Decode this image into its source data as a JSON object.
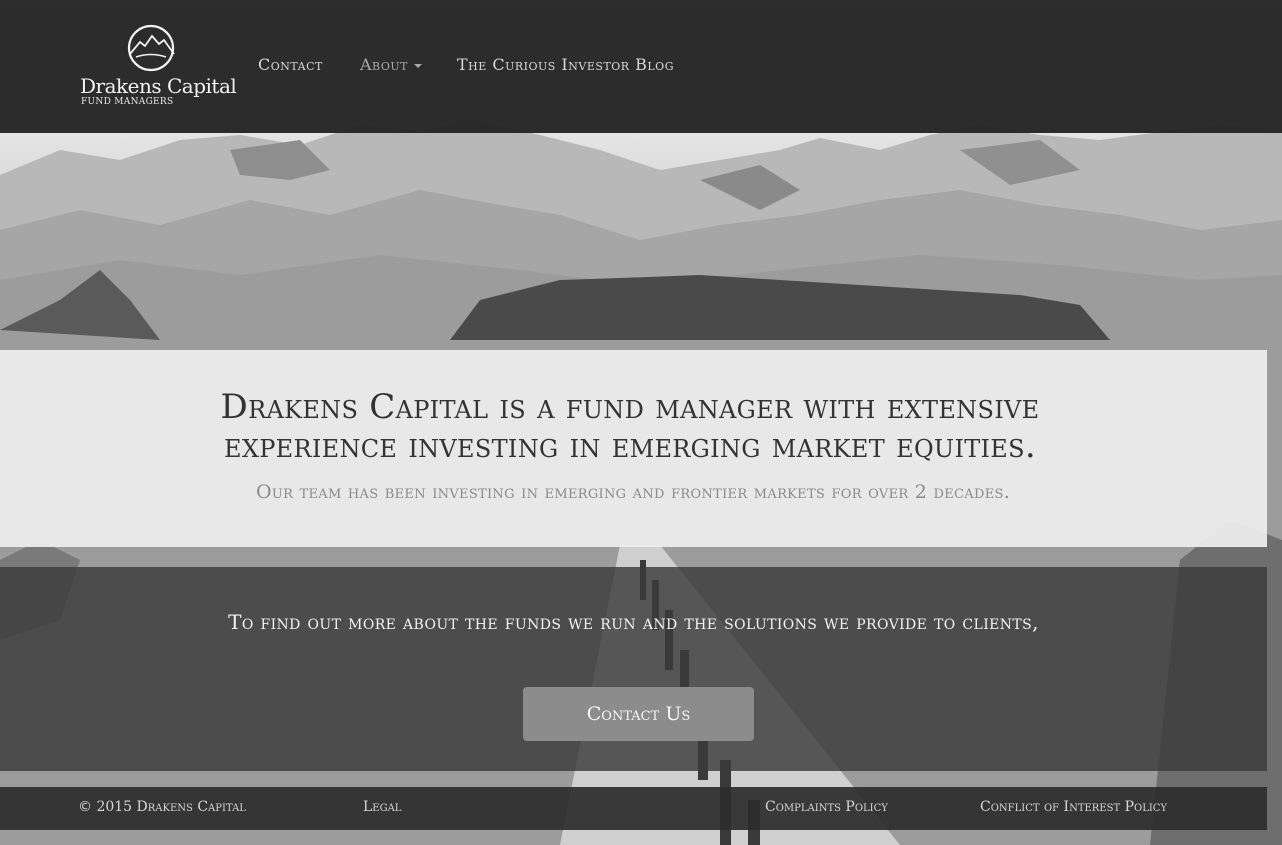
{
  "brand": {
    "name": "Drakens Capital",
    "tagline": "FUND MANAGERS",
    "logo_icon": "mountain-sun-icon"
  },
  "nav": {
    "contact": "Contact",
    "about": "About",
    "blog": "The Curious Investor Blog"
  },
  "hero": {
    "title": "Drakens Capital is a fund manager with extensive experience investing in emerging market equities.",
    "subtitle": "Our team has been investing in emerging and frontier markets for over 2 decades."
  },
  "cta": {
    "text": "To find out more about the funds we run and the solutions we provide to clients,",
    "button": "Contact Us"
  },
  "footer": {
    "copyright_symbol": "©",
    "copyright": "2015 Drakens Capital",
    "legal": "Legal",
    "complaints": "Complaints Policy",
    "conflict": "Conflict of Interest Policy"
  },
  "colors": {
    "navbar": "#222222",
    "panel_light": "#eeeeee",
    "panel_dark": "#3a3a3a",
    "button": "#8c8c8c"
  }
}
